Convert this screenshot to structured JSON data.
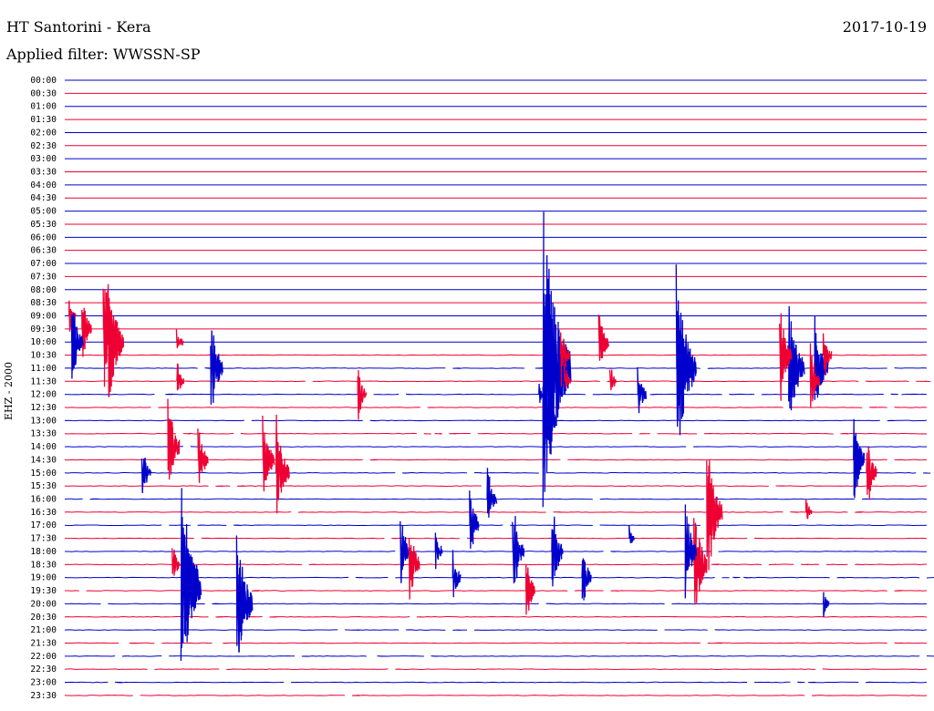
{
  "header": {
    "station": "HT Santorini - Kera",
    "date": "2017-10-19",
    "filter": "Applied filter: WWSSN-SP"
  },
  "channel_label": "EHZ - 2000",
  "colors": {
    "blue": "#0000cc",
    "red": "#ee0033"
  },
  "chart_data": {
    "type": "line",
    "title": "HT Santorini - Kera",
    "subtitle": "Applied filter: WWSSN-SP",
    "ylabel": "EHZ - 2000",
    "tick_labels": [
      "00:00",
      "00:30",
      "01:00",
      "01:30",
      "02:00",
      "02:30",
      "03:00",
      "03:30",
      "04:00",
      "04:30",
      "05:00",
      "05:30",
      "06:00",
      "06:30",
      "07:00",
      "07:30",
      "08:00",
      "08:30",
      "09:00",
      "09:30",
      "10:00",
      "10:30",
      "11:00",
      "11:30",
      "12:00",
      "12:30",
      "13:00",
      "13:30",
      "14:00",
      "14:30",
      "15:00",
      "15:30",
      "16:00",
      "16:30",
      "17:00",
      "17:30",
      "18:00",
      "18:30",
      "19:00",
      "19:30",
      "20:00",
      "20:30",
      "21:00",
      "21:30",
      "22:00",
      "22:30",
      "23:00",
      "23:30"
    ],
    "series": [
      {
        "color": "blue",
        "rows": "even"
      },
      {
        "color": "red",
        "rows": "odd"
      }
    ],
    "events": [
      {
        "row": 18,
        "x": 0.005,
        "amp": 1.8,
        "color": "red"
      },
      {
        "row": 19,
        "x": 0.02,
        "amp": 3.0,
        "color": "red"
      },
      {
        "row": 19,
        "x": 0.045,
        "amp": 5.5,
        "color": "red"
      },
      {
        "row": 20,
        "x": 0.05,
        "amp": 6.0,
        "color": "red"
      },
      {
        "row": 20,
        "x": 0.008,
        "amp": 4.0,
        "color": "blue"
      },
      {
        "row": 22,
        "x": 0.17,
        "amp": 4.0,
        "color": "blue"
      },
      {
        "row": 23,
        "x": 0.13,
        "amp": 2.0,
        "color": "red"
      },
      {
        "row": 20,
        "x": 0.13,
        "amp": 1.5,
        "color": "red"
      },
      {
        "row": 28,
        "x": 0.12,
        "amp": 4.0,
        "color": "red"
      },
      {
        "row": 29,
        "x": 0.155,
        "amp": 3.0,
        "color": "red"
      },
      {
        "row": 30,
        "x": 0.09,
        "amp": 2.5,
        "color": "blue"
      },
      {
        "row": 29,
        "x": 0.23,
        "amp": 4.0,
        "color": "red"
      },
      {
        "row": 30,
        "x": 0.245,
        "amp": 5.0,
        "color": "red"
      },
      {
        "row": 38,
        "x": 0.135,
        "amp": 7.0,
        "color": "blue"
      },
      {
        "row": 39,
        "x": 0.14,
        "amp": 6.0,
        "color": "blue"
      },
      {
        "row": 40,
        "x": 0.2,
        "amp": 6.0,
        "color": "blue"
      },
      {
        "row": 37,
        "x": 0.125,
        "amp": 2.0,
        "color": "red"
      },
      {
        "row": 24,
        "x": 0.34,
        "amp": 2.5,
        "color": "red"
      },
      {
        "row": 36,
        "x": 0.39,
        "amp": 3.0,
        "color": "blue"
      },
      {
        "row": 37,
        "x": 0.4,
        "amp": 3.5,
        "color": "red"
      },
      {
        "row": 36,
        "x": 0.43,
        "amp": 2.0,
        "color": "blue"
      },
      {
        "row": 38,
        "x": 0.45,
        "amp": 2.5,
        "color": "blue"
      },
      {
        "row": 34,
        "x": 0.47,
        "amp": 3.0,
        "color": "blue"
      },
      {
        "row": 32,
        "x": 0.49,
        "amp": 3.0,
        "color": "blue"
      },
      {
        "row": 36,
        "x": 0.52,
        "amp": 4.0,
        "color": "blue"
      },
      {
        "row": 39,
        "x": 0.535,
        "amp": 3.0,
        "color": "red"
      },
      {
        "row": 36,
        "x": 0.565,
        "amp": 4.0,
        "color": "blue"
      },
      {
        "row": 24,
        "x": 0.55,
        "amp": 1.0,
        "color": "blue"
      },
      {
        "row": 22,
        "x": 0.555,
        "amp": 12.0,
        "color": "blue"
      },
      {
        "row": 26,
        "x": 0.555,
        "amp": 5.0,
        "color": "blue"
      },
      {
        "row": 21,
        "x": 0.575,
        "amp": 3.0,
        "color": "red"
      },
      {
        "row": 23,
        "x": 0.58,
        "amp": 1.5,
        "color": "red"
      },
      {
        "row": 20,
        "x": 0.62,
        "amp": 3.0,
        "color": "red"
      },
      {
        "row": 23,
        "x": 0.633,
        "amp": 1.5,
        "color": "red"
      },
      {
        "row": 24,
        "x": 0.665,
        "amp": 2.5,
        "color": "blue"
      },
      {
        "row": 22,
        "x": 0.71,
        "amp": 8.0,
        "color": "blue"
      },
      {
        "row": 37,
        "x": 0.73,
        "amp": 5.0,
        "color": "red"
      },
      {
        "row": 36,
        "x": 0.72,
        "amp": 4.0,
        "color": "blue"
      },
      {
        "row": 33,
        "x": 0.745,
        "amp": 6.0,
        "color": "red"
      },
      {
        "row": 22,
        "x": 0.84,
        "amp": 6.0,
        "color": "blue"
      },
      {
        "row": 21,
        "x": 0.83,
        "amp": 4.0,
        "color": "red"
      },
      {
        "row": 22,
        "x": 0.87,
        "amp": 5.0,
        "color": "blue"
      },
      {
        "row": 23,
        "x": 0.865,
        "amp": 3.0,
        "color": "red"
      },
      {
        "row": 21,
        "x": 0.88,
        "amp": 2.5,
        "color": "red"
      },
      {
        "row": 29,
        "x": 0.915,
        "amp": 4.0,
        "color": "blue"
      },
      {
        "row": 30,
        "x": 0.93,
        "amp": 3.5,
        "color": "red"
      },
      {
        "row": 33,
        "x": 0.86,
        "amp": 1.5,
        "color": "red"
      },
      {
        "row": 40,
        "x": 0.88,
        "amp": 1.5,
        "color": "blue"
      },
      {
        "row": 35,
        "x": 0.655,
        "amp": 1.0,
        "color": "blue"
      },
      {
        "row": 38,
        "x": 0.6,
        "amp": 3.0,
        "color": "blue"
      }
    ],
    "grid": false
  }
}
